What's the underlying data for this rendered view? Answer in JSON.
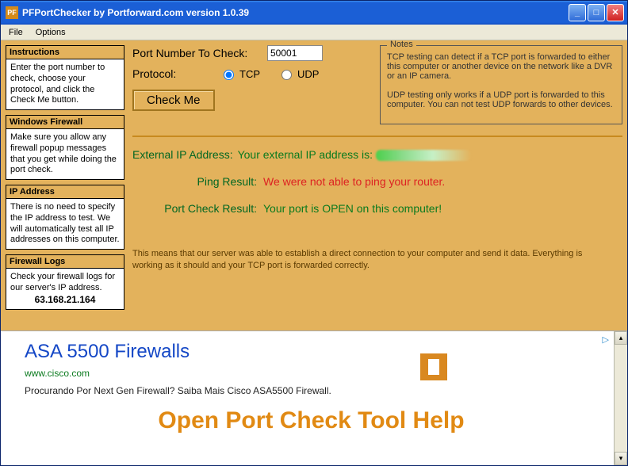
{
  "window": {
    "title": "PFPortChecker by Portforward.com version 1.0.39",
    "icon_text": "PF"
  },
  "menu": {
    "file": "File",
    "options": "Options"
  },
  "sidebar": {
    "instructions": {
      "title": "Instructions",
      "body": "Enter the port number to check, choose your protocol, and click the Check Me button."
    },
    "firewall": {
      "title": "Windows Firewall",
      "body": "Make sure you allow any firewall popup messages that you get while doing the port check."
    },
    "ip": {
      "title": "IP Address",
      "body": "There is no need to specify the IP address to test. We will automatically test all IP addresses on this computer."
    },
    "logs": {
      "title": "Firewall Logs",
      "body": "Check your firewall logs for our server's IP address.",
      "ip": "63.168.21.164"
    }
  },
  "form": {
    "port_label": "Port Number To Check:",
    "port_value": "50001",
    "protocol_label": "Protocol:",
    "tcp": "TCP",
    "udp": "UDP",
    "check": "Check Me"
  },
  "notes": {
    "legend": "Notes",
    "line1": "TCP testing can detect if a TCP port is forwarded to either this computer or another device on the network like a DVR or an IP camera.",
    "line2": "UDP testing only works if a UDP port is forwarded to this computer. You can not test UDP forwards to other devices."
  },
  "results": {
    "ext_ip_label": "External IP Address:",
    "ext_ip_val": "Your external IP address is: ",
    "ping_label": "Ping Result:",
    "ping_val": "We were not able to ping your router.",
    "port_label": "Port Check Result:",
    "port_val": "Your port is OPEN on this computer!",
    "explain": "This means that our server was able to establish a direct connection to your computer and send it data. Everything is working as it should and your TCP port is forwarded correctly."
  },
  "ad": {
    "title": "ASA 5500 Firewalls",
    "url": "www.cisco.com",
    "desc": "Procurando Por Next Gen Firewall? Saiba Mais Cisco ASA5500 Firewall.",
    "help": "Open Port Check Tool Help",
    "choices_glyph": "▷"
  }
}
